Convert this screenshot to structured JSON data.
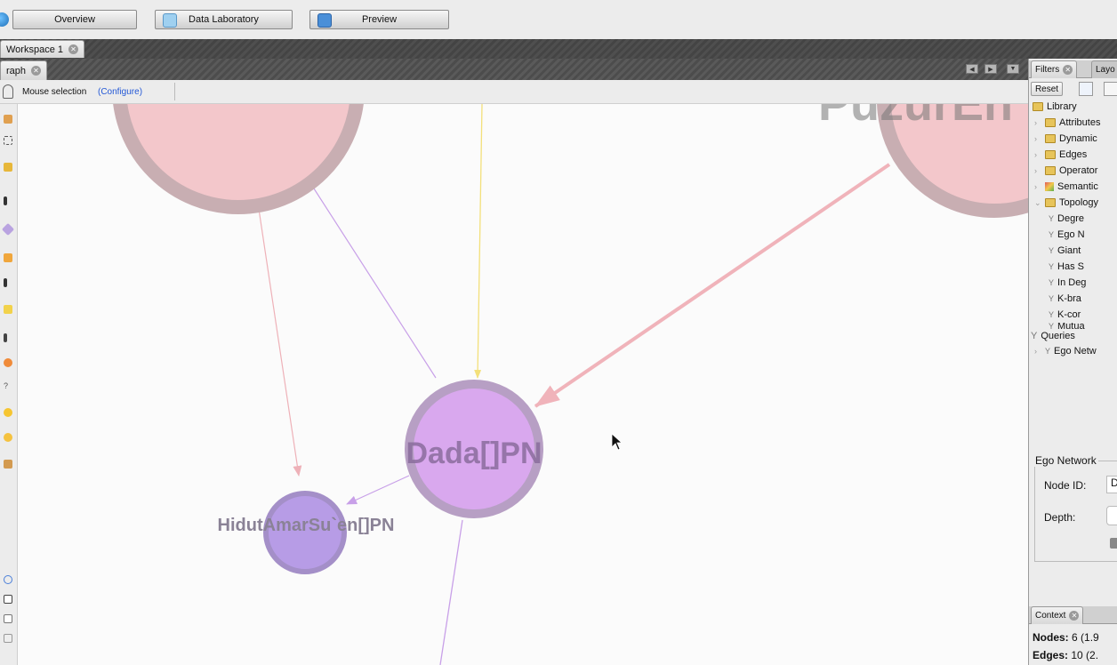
{
  "top_buttons": {
    "overview": "Overview",
    "data_lab": "Data Laboratory",
    "preview": "Preview"
  },
  "workspace_tab": "Workspace 1",
  "graph_tab": "raph",
  "toolbar": {
    "mouse_selection": "Mouse selection",
    "configure": "(Configure)"
  },
  "graph": {
    "nodes": [
      {
        "label": "Dada[]PN",
        "color": "#d9a8ee",
        "ring": "#b79fc4"
      },
      {
        "label": "HidutAmarSu`en[]PN",
        "color": "#b79ce6",
        "ring": "#a48fc8"
      },
      {
        "label": "",
        "color": "#f3c7cb"
      },
      {
        "label": "PuzurEn",
        "color": "#f3c7cb"
      }
    ],
    "edge_colors": {
      "pink": "#eeb1b8",
      "violet": "#c8a0e8",
      "yellow": "#f3e07a"
    }
  },
  "right_panel": {
    "tabs": [
      "Filters",
      "Layo"
    ],
    "reset": "Reset",
    "library": "Library",
    "folders": [
      "Attributes",
      "Dynamic",
      "Edges",
      "Operator",
      "Semantic",
      "Topology"
    ],
    "topology_items": [
      "Degre",
      "Ego N",
      "Giant",
      "Has S",
      "In Deg",
      "K-bra",
      "K-cor",
      "Mutua"
    ],
    "queries": "Queries",
    "query_item": "Ego Netw",
    "ego_panel": {
      "title": "Ego Network",
      "node_id_label": "Node ID:",
      "node_id_value": "D",
      "depth_label": "Depth:"
    },
    "context": {
      "tab": "Context",
      "nodes_label": "Nodes:",
      "nodes_value": "6 (1.9",
      "edges_label": "Edges:",
      "edges_value": "10 (2."
    }
  }
}
